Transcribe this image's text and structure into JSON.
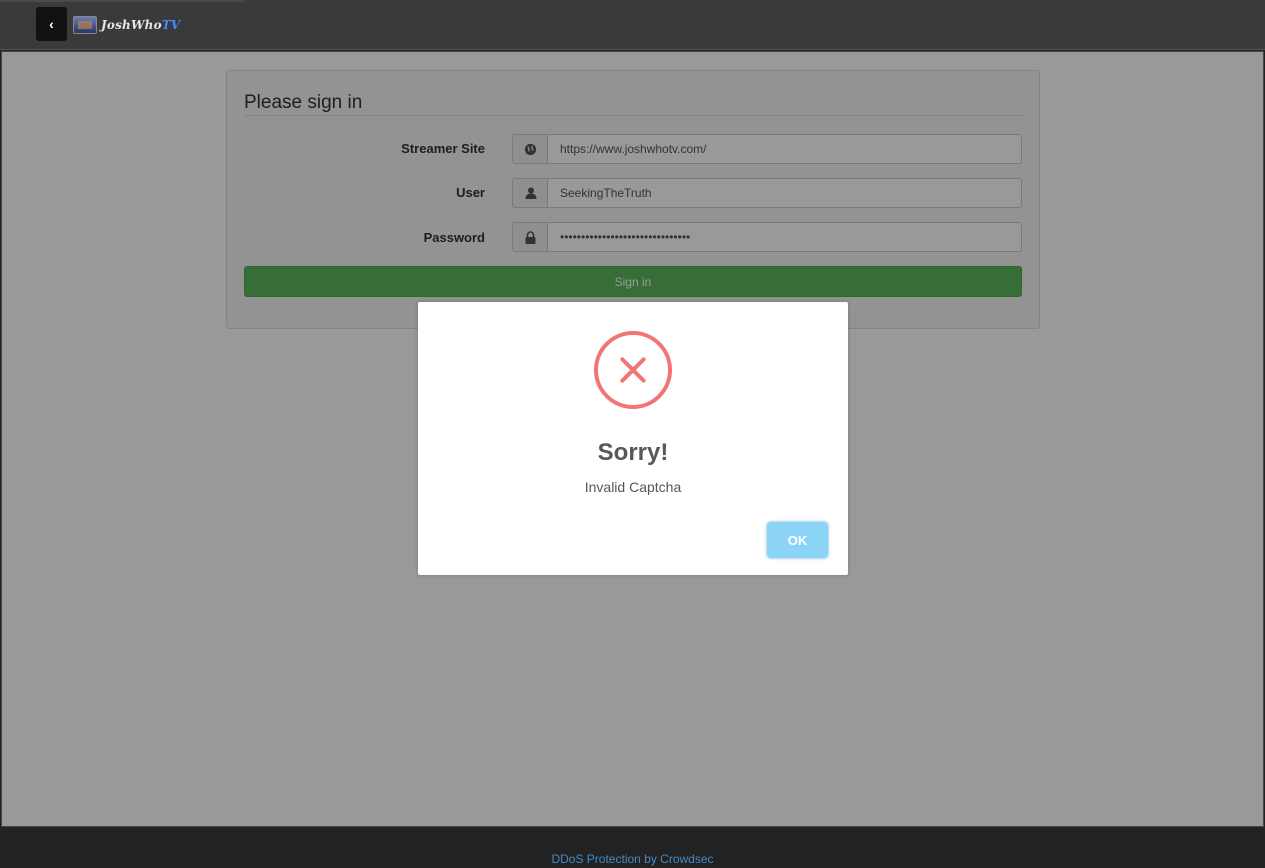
{
  "header": {
    "back_icon": "chevron-left-icon",
    "back_glyph": "‹",
    "logo_text_main": "JoshWho",
    "logo_text_accent": "TV"
  },
  "signin": {
    "title": "Please sign in",
    "fields": [
      {
        "label": "Streamer Site",
        "icon": "globe-icon",
        "glyph": "🌐",
        "value": "https://www.joshwhotv.com/"
      },
      {
        "label": "User",
        "icon": "user-icon",
        "glyph": "👤",
        "value": "SeekingTheTruth"
      },
      {
        "label": "Password",
        "icon": "lock-icon",
        "glyph": "🔒",
        "value": "•••••••••••••••••••••••••••••••"
      }
    ],
    "submit_label": "Sign in"
  },
  "dialog": {
    "icon": "error-x-icon",
    "title": "Sorry!",
    "message": "Invalid Captcha",
    "ok_label": "OK"
  },
  "footer": {
    "link_text": "DDoS Protection by Crowdsec"
  },
  "colors": {
    "success_green": "#5cb85c",
    "error_red": "#f27474",
    "ok_blue": "#8cd4f5",
    "link_blue": "#428bca"
  }
}
